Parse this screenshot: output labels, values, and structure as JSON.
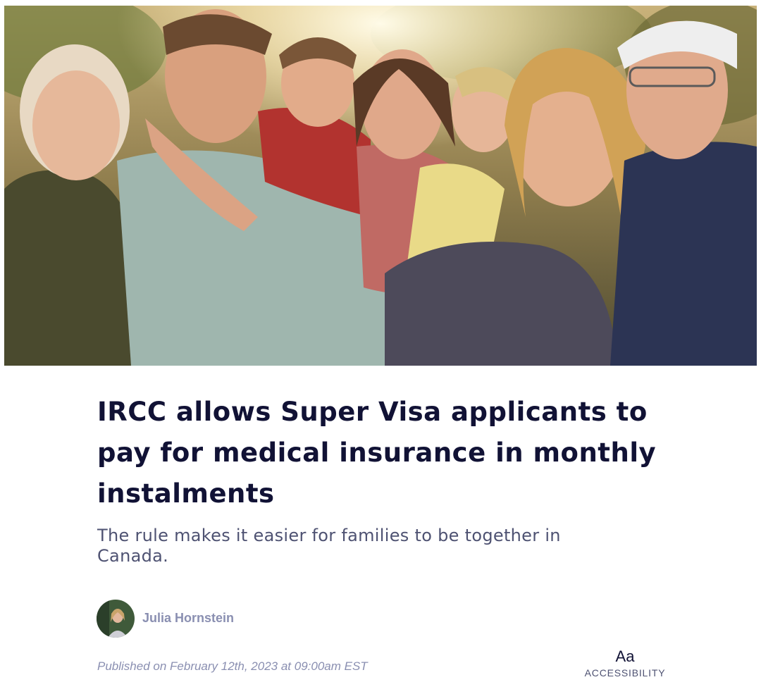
{
  "hero": {
    "alt": "Multi-generation family smiling together outdoors"
  },
  "article": {
    "title": "IRCC allows Super Visa applicants to pay for medical insurance in monthly instalments",
    "subtitle": "The rule makes it easier for families to be together in Canada.",
    "author": {
      "name": "Julia Hornstein",
      "avatar_icon": "author-avatar"
    },
    "published": "Published on February 12th, 2023 at 09:00am EST"
  },
  "accessibility": {
    "icon_text": "Aa",
    "label": "ACCESSIBILITY"
  },
  "colors": {
    "title": "#111235",
    "subtitle": "#4e5272",
    "meta": "#8a8fb1"
  }
}
